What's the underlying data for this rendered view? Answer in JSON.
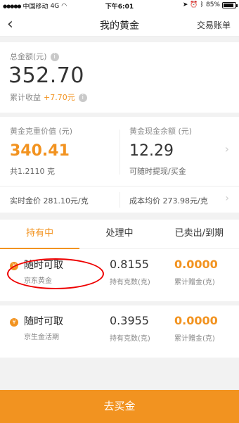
{
  "status_bar": {
    "carrier": "中国移动",
    "network": "4G",
    "time": "下午6:01",
    "battery_pct": "85%",
    "battery_level": 0.85
  },
  "nav": {
    "back_icon": "chevron-left-icon",
    "title": "我的黄金",
    "right_link": "交易账单"
  },
  "summary": {
    "total_label": "总金额(元)",
    "total_amount": "352.70",
    "earnings_label": "累计收益",
    "earnings_value": "+7.70元",
    "info_icon": "info-icon"
  },
  "gold_value": {
    "label": "黄金克重价值 (元)",
    "value": "340.41",
    "grams_line": "共1.2110 克"
  },
  "cash_balance": {
    "label": "黄金现金余额 (元)",
    "value": "12.29",
    "note": "可随时提现/买金"
  },
  "prices": {
    "realtime": "实时金价  281.10元/克",
    "avg_cost": "成本均价  273.98元/克"
  },
  "tabs": [
    {
      "label": "持有中",
      "active": true
    },
    {
      "label": "处理中",
      "active": false
    },
    {
      "label": "已卖出/到期",
      "active": false
    }
  ],
  "holdings": [
    {
      "badge": "¥",
      "title": "随时可取",
      "subtitle": "京东黄金",
      "grams": "0.8155",
      "grams_label": "持有克数(克)",
      "gift": "0.0000",
      "gift_label": "累计赠金(克)"
    },
    {
      "badge": "¥",
      "title": "随时可取",
      "subtitle": "京生金活期",
      "grams": "0.3955",
      "grams_label": "持有克数(克)",
      "gift": "0.0000",
      "gift_label": "累计赠金(克)"
    }
  ],
  "cta": {
    "label": "去买金"
  },
  "colors": {
    "accent": "#f29320",
    "annotation": "#e00000",
    "background": "#f2f2f2"
  }
}
